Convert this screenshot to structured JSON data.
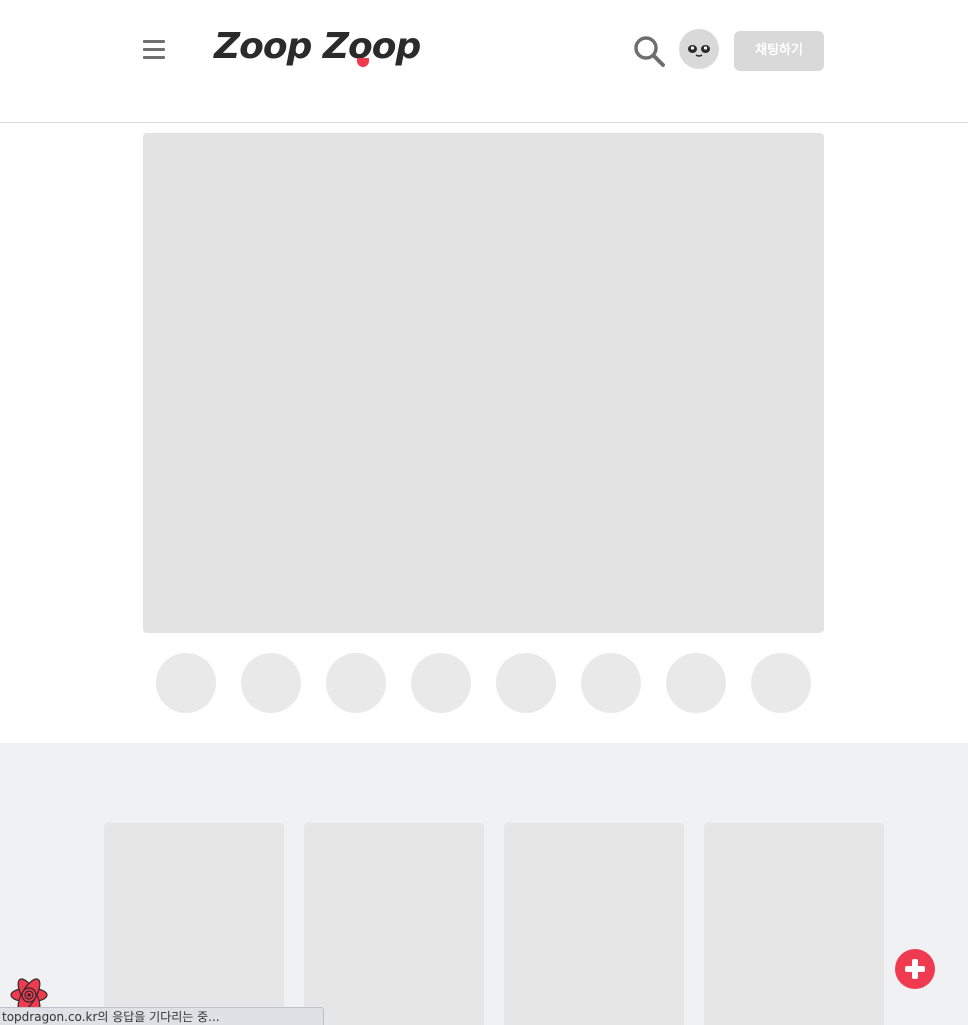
{
  "header": {
    "logo_text": "Zoop Zoop",
    "chat_button_label": "채팅하기"
  },
  "icons": {
    "menu": "hamburger-icon",
    "search": "search-icon",
    "avatar": "panda-face-icon",
    "fab": "plus-icon",
    "extension": "react-devtools-icon"
  },
  "colors": {
    "brand_red": "#f03a4f",
    "skeleton": "#e3e3e4",
    "section_bg": "#f0f1f3",
    "logo_text": "#2b2b2b"
  },
  "status_bar": {
    "text": "topdragon.co.kr의 응답을 기다리는 중..."
  }
}
